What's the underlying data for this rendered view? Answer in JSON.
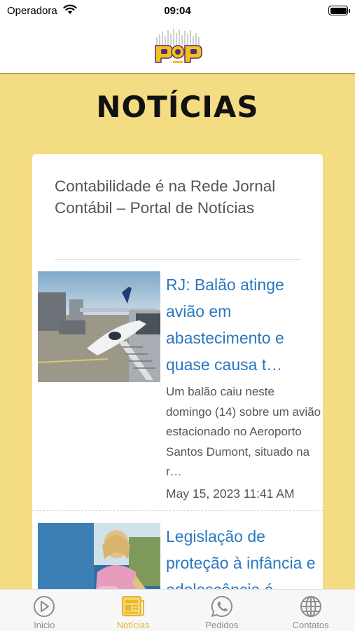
{
  "status_bar": {
    "carrier": "Operadora",
    "time": "09:04"
  },
  "page": {
    "title": "NOTÍCIAS"
  },
  "feed": {
    "source_title": "Contabilidade é na Rede Jornal Contábil – Portal de Notícias",
    "items": [
      {
        "title": "RJ: Balão atinge avião em abastecimento e quase causa t…",
        "description": "Um balão caiu neste domingo (14) sobre um avião estacionado no Aeroporto Santos Dumont, situado na r…",
        "date": "May 15, 2023 11:41 AM"
      },
      {
        "title": "Legislação de proteção à infância e adolescência é"
      }
    ]
  },
  "tabs": [
    {
      "label": "Inicio",
      "icon": "play-circle-icon"
    },
    {
      "label": "Notícias",
      "icon": "newspaper-icon",
      "active": true
    },
    {
      "label": "Pedidos",
      "icon": "whatsapp-icon"
    },
    {
      "label": "Contatos",
      "icon": "globe-icon"
    }
  ],
  "colors": {
    "background": "#f4dc82",
    "accent": "#e3b72f",
    "link": "#2b78c2"
  }
}
